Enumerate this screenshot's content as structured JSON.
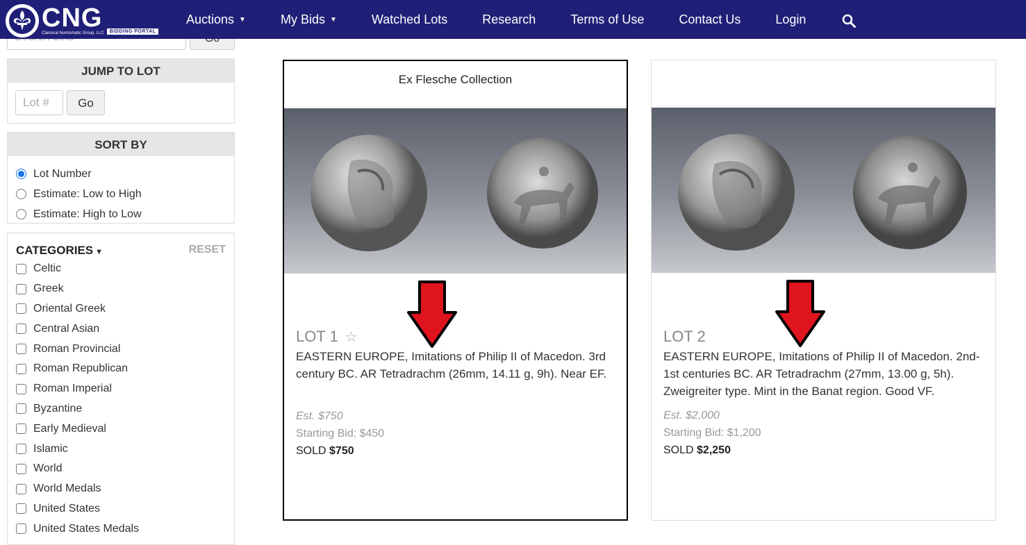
{
  "nav": {
    "brand": "CNG",
    "brand_sub": "Classical Numismatic Group, LLC",
    "portal_badge": "BIDDING PORTAL",
    "items": [
      {
        "label": "Auctions",
        "caret": true
      },
      {
        "label": "My Bids",
        "caret": true
      },
      {
        "label": "Watched Lots",
        "caret": false
      },
      {
        "label": "Research",
        "caret": false
      },
      {
        "label": "Terms of Use",
        "caret": false
      },
      {
        "label": "Contact Us",
        "caret": false
      },
      {
        "label": "Login",
        "caret": false
      }
    ],
    "search_icon": "search-icon"
  },
  "sidebar": {
    "search": {
      "placeholder": "Search Lots",
      "button": "Go"
    },
    "jump": {
      "title": "JUMP TO LOT",
      "placeholder": "Lot #",
      "button": "Go"
    },
    "sort": {
      "title": "SORT BY",
      "options": [
        "Lot Number",
        "Estimate: Low to High",
        "Estimate: High to Low"
      ],
      "selected": "Lot Number"
    },
    "categories": {
      "title": "CATEGORIES",
      "reset": "RESET",
      "items": [
        "Celtic",
        "Greek",
        "Oriental Greek",
        "Central Asian",
        "Roman Provincial",
        "Roman Republican",
        "Roman Imperial",
        "Byzantine",
        "Early Medieval",
        "Islamic",
        "World",
        "World Medals",
        "United States",
        "United States Medals"
      ]
    }
  },
  "lots": [
    {
      "ribbon": "Ex Flesche Collection",
      "title": "LOT 1",
      "star": "☆",
      "description": "EASTERN EUROPE, Imitations of Philip II of Macedon. 3rd century BC. AR Tetradrachm (26mm, 14.11 g, 9h). Near EF.",
      "estimate": "Est. $750",
      "starting_bid": "Starting Bid: $450",
      "sold_label": "SOLD",
      "sold_price": "$750"
    },
    {
      "ribbon": "",
      "title": "LOT 2",
      "description": "EASTERN EUROPE, Imitations of Philip II of Macedon. 2nd-1st centuries BC. AR Tetradrachm (27mm, 13.00 g, 5h). Zweigreiter type. Mint in the Banat region. Good VF.",
      "estimate": "Est. $2,000",
      "starting_bid": "Starting Bid: $1,200",
      "sold_label": "SOLD",
      "sold_price": "$2,250"
    }
  ],
  "colors": {
    "navbar": "#1f1f78",
    "arrow": "#e0141e",
    "radio_selected": "#1a73e8"
  }
}
